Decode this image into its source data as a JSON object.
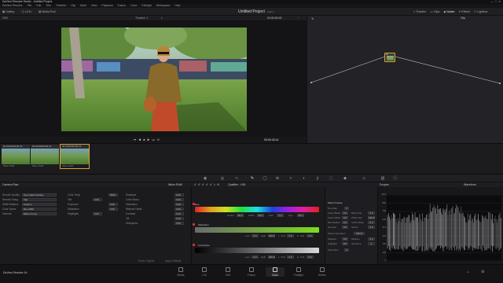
{
  "app": {
    "window_title": "DaVinci Resolve Studio - Untitled Project",
    "project_title": "Untitled Project",
    "project_status": "Edited"
  },
  "menu": [
    "DaVinci Resolve",
    "File",
    "Edit",
    "Trim",
    "Timeline",
    "Clip",
    "Mark",
    "View",
    "Playback",
    "Fusion",
    "Color",
    "Fairlight",
    "Workspace",
    "Help"
  ],
  "toolbar": {
    "left": [
      {
        "label": "Gallery",
        "icon": "gallery-icon"
      },
      {
        "label": "LUTs",
        "icon": "luts-icon"
      },
      {
        "label": "Media Pool",
        "icon": "media-pool-icon"
      }
    ],
    "right": [
      {
        "label": "Timeline",
        "icon": "timeline-icon"
      },
      {
        "label": "Clips",
        "icon": "clips-icon"
      },
      {
        "label": "Nodes",
        "icon": "nodes-icon"
      },
      {
        "label": "Effects",
        "icon": "effects-icon"
      },
      {
        "label": "Lightbox",
        "icon": "lightbox-icon"
      }
    ]
  },
  "viewer": {
    "zoom": "25%",
    "timeline_name": "Timeline 1",
    "source_tc": "00:00:00:00",
    "playhead_tc": "00:00:43:14"
  },
  "nodes": {
    "mode": "Clip",
    "node_label": "01"
  },
  "clips": [
    {
      "number": "01",
      "tc": "00:00:00:00",
      "codec": "V1",
      "name": "Nikon RAW"
    },
    {
      "number": "02",
      "tc": "00:00:00:00",
      "codec": "V1",
      "name": "Nikon RAW"
    },
    {
      "number": "03",
      "tc": "00:00:00:00",
      "codec": "V1",
      "name": "Nikon RAW"
    }
  ],
  "panels": {
    "camera_raw": "Camera Raw",
    "raw_source": "Nikon RAW",
    "qualifier": "Qualifier - HSL",
    "scopes": "Scopes",
    "scope_mode": "Waveform"
  },
  "camera_raw": {
    "col1": [
      {
        "label": "Decode Quality",
        "value": "Use project setting"
      },
      {
        "label": "Decode Using",
        "value": "Clip"
      },
      {
        "label": "White Balance",
        "value": "Custom"
      },
      {
        "label": "Color Space",
        "value": "Rec.2020"
      },
      {
        "label": "Gamma",
        "value": "Nikon N-Log"
      }
    ],
    "col2": [
      {
        "label": "Color Temp",
        "value": "5560"
      },
      {
        "label": "Tint",
        "value": "0.00"
      },
      {
        "label": "Exposure",
        "value": "0.00"
      },
      {
        "label": "Saturation",
        "value": "0.00"
      },
      {
        "label": "Highlights",
        "value": "0.00"
      }
    ],
    "col3": [
      {
        "label": "Shadows",
        "value": "0.00"
      },
      {
        "label": "Color Boost",
        "value": "0.00"
      },
      {
        "label": "Saturation",
        "value": "0.00"
      },
      {
        "label": "Midtone Detail",
        "value": "0.00"
      },
      {
        "label": "Contrast",
        "value": "0.00"
      },
      {
        "label": "Lift",
        "value": "0.00"
      },
      {
        "label": "Sharpness",
        "value": "0.00"
      }
    ],
    "buttons": {
      "reset": "Reset Original",
      "apply": "Apply Settings"
    }
  },
  "qualifier": {
    "hue": {
      "label": "Hue",
      "fields": [
        {
          "k": "Center",
          "v": "50.0"
        },
        {
          "k": "Width",
          "v": "50.0"
        },
        {
          "k": "Soft",
          "v": "0.0"
        },
        {
          "k": "Sym",
          "v": "50.0"
        }
      ]
    },
    "saturation": {
      "label": "Saturation",
      "fields": [
        {
          "k": "Low",
          "v": "0.0"
        },
        {
          "k": "High",
          "v": "100.0"
        },
        {
          "k": "L. Soft",
          "v": "0.0"
        },
        {
          "k": "H. Soft",
          "v": "0.0"
        }
      ]
    },
    "luminance": {
      "label": "Luminance",
      "fields": [
        {
          "k": "Low",
          "v": "0.0"
        },
        {
          "k": "High",
          "v": "100.0"
        },
        {
          "k": "L. Soft",
          "v": "0.0"
        },
        {
          "k": "H. Soft",
          "v": "0.0"
        }
      ]
    }
  },
  "matte_finesse": {
    "title": "Matte Finesse",
    "rows": [
      {
        "k": "Pre-Filter",
        "v": "0"
      },
      {
        "k": "Clean Black",
        "v": "0.0",
        "k2": "Black Clip",
        "v2": "0.0"
      },
      {
        "k": "Clean White",
        "v": "0.0",
        "k2": "White Clip",
        "v2": "100.0"
      },
      {
        "k": "Blur Radius",
        "v": "0.0",
        "k2": "In/Out Ratio",
        "v2": "0.0"
      },
      {
        "k": "Denoise",
        "v": "0.0",
        "k2": "Shrink",
        "v2": "0.0"
      },
      {
        "k": "Morph Operation",
        "v": "Shrink"
      },
      {
        "k": "Shadow",
        "v": "0.0",
        "k2": "Midtone",
        "v2": "0.0"
      },
      {
        "k": "Highlight",
        "v": "0.0",
        "k2": "Iterations",
        "v2": "0"
      },
      {
        "k": "Post-Filter",
        "v": "0"
      }
    ]
  },
  "scope_ticks": [
    "1023",
    "896",
    "768",
    "640",
    "512",
    "384",
    "256",
    "128",
    "0"
  ],
  "bottom_nav": {
    "app_name": "DaVinci Resolve 16",
    "pages": [
      {
        "label": "Media",
        "icon": "media-page-icon"
      },
      {
        "label": "Cut",
        "icon": "cut-page-icon"
      },
      {
        "label": "Edit",
        "icon": "edit-page-icon"
      },
      {
        "label": "Fusion",
        "icon": "fusion-page-icon"
      },
      {
        "label": "Color",
        "icon": "color-page-icon"
      },
      {
        "label": "Fairlight",
        "icon": "fairlight-page-icon"
      },
      {
        "label": "Deliver",
        "icon": "deliver-page-icon"
      }
    ],
    "active_page": "Color"
  },
  "colors": {
    "accent": "#e0a030",
    "hue_red": "#e03030",
    "saturation_green": "#7ddc1e"
  }
}
